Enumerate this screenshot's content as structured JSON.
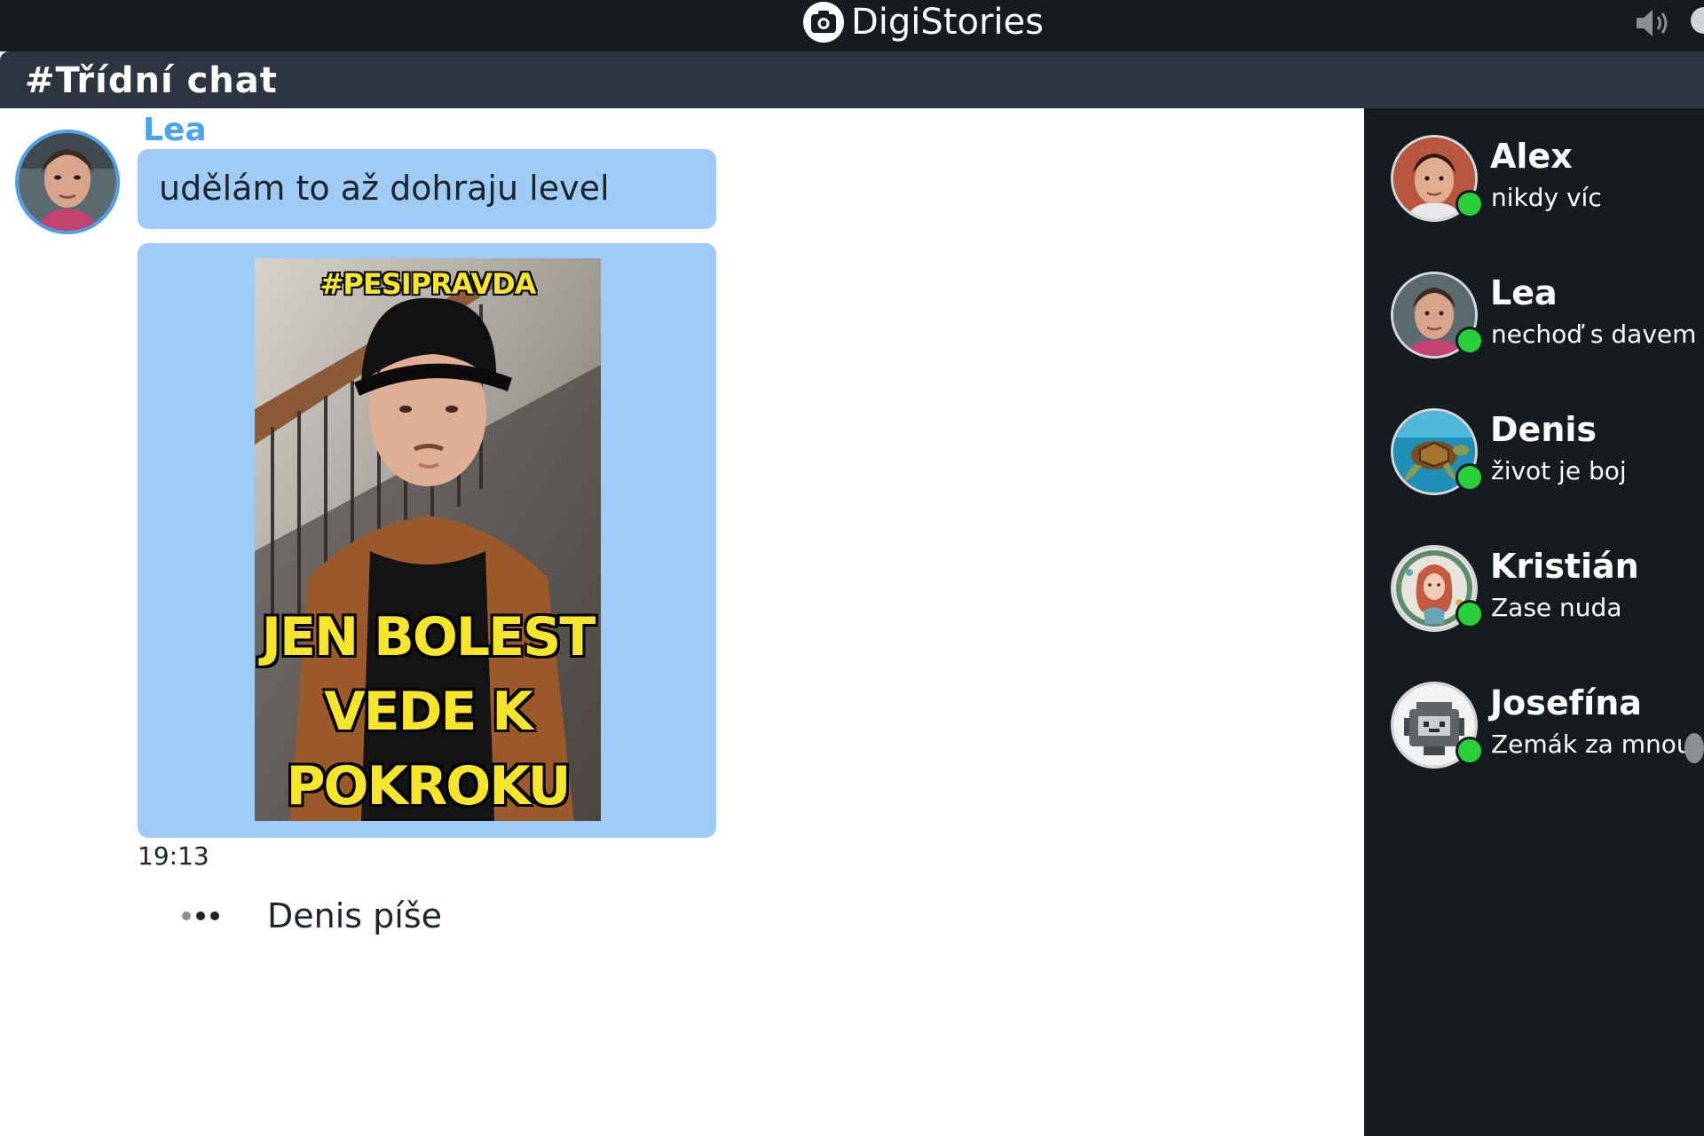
{
  "app": {
    "name": "DigiStories",
    "icons": {
      "logo": "camera-icon",
      "sound": "speaker-icon"
    }
  },
  "channel": {
    "title": "#Třídní chat"
  },
  "messages": [
    {
      "sender": "Lea",
      "text": "udělám to až dohraju level",
      "image": {
        "tag": "#PESIPRAVDA",
        "caption_lines": [
          "JEN BOLEST",
          "VEDE K",
          "POKROKU"
        ]
      },
      "time": "19:13"
    }
  ],
  "typing": {
    "text": "Denis píše"
  },
  "contacts": [
    {
      "name": "Alex",
      "status": "nikdy víc",
      "online": true
    },
    {
      "name": "Lea",
      "status": "nechoď s davem",
      "online": true
    },
    {
      "name": "Denis",
      "status": "život je boj",
      "online": true
    },
    {
      "name": "Kristián",
      "status": "Zase nuda",
      "online": true
    },
    {
      "name": "Josefína",
      "status": "Zemák za mnou",
      "online": true
    }
  ],
  "colors": {
    "topbar": "#161b20",
    "channelbar": "#2c3640",
    "bubble": "#9fccf7",
    "sender": "#4aa3ec",
    "online": "#27d03b",
    "poster_text": "#f6e52b"
  }
}
